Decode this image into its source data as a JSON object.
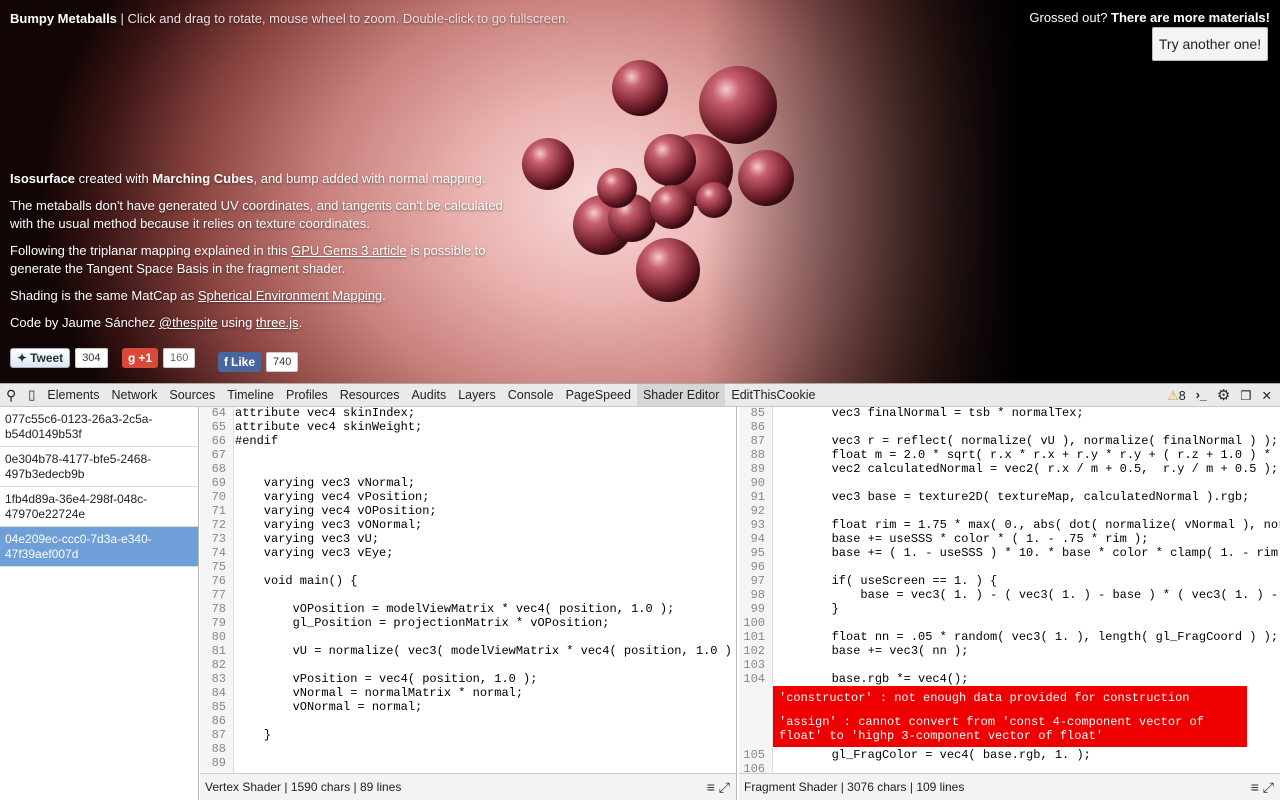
{
  "scene": {
    "title": "Bumpy Metaballs",
    "title_sub": " | Click and drag to rotate, mouse wheel to zoom. Double-click to go fullscreen.",
    "materials_prefix": "Grossed out? ",
    "materials_bold": "There are more materials!",
    "try_button": "Try another one!",
    "p1_b1": "Isosurface",
    "p1_t1": " created with ",
    "p1_b2": "Marching Cubes",
    "p1_t2": ", and bump added with normal mapping.",
    "p2": "The metaballs don't have generated UV coordinates, and tangents can't be calculated with the usual method because it relies on texture coordinates.",
    "p3_t1": "Following the triplanar mapping explained in this ",
    "p3_link": "GPU Gems 3 article",
    "p3_t2": " is possible to generate the Tangent Space Basis in the fragment shader.",
    "p4_t1": "Shading is the same MatCap as ",
    "p4_link": "Spherical Environment Mapping",
    "p4_t2": ".",
    "p5_t1": "Code by Jaume Sánchez ",
    "p5_link1": "@thespite",
    "p5_t2": " using ",
    "p5_link2": "three.js",
    "p5_t3": "."
  },
  "social": {
    "tweet_label": "Tweet",
    "tweet_count": "304",
    "gplus_label": "+1",
    "gplus_count": "160",
    "fb_label": "Like",
    "fb_count": "740"
  },
  "devtools": {
    "tabs": [
      "Elements",
      "Network",
      "Sources",
      "Timeline",
      "Profiles",
      "Resources",
      "Audits",
      "Layers",
      "Console",
      "PageSpeed",
      "Shader Editor",
      "EditThisCookie"
    ],
    "warnings": "8"
  },
  "programs": [
    "077c55c6-0123-26a3-2c5a-b54d0149b53f",
    "0e304b78-4177-bfe5-2468-497b3edecb9b",
    "1fb4d89a-36e4-298f-048c-47970e22724e",
    "04e209ec-ccc0-7d3a-e340-47f39aef007d"
  ],
  "vertex": {
    "status": "Vertex Shader | 1590 chars | 89 lines",
    "lines": [
      [
        "64",
        "attribute vec4 skinIndex;"
      ],
      [
        "65",
        "attribute vec4 skinWeight;"
      ],
      [
        "66",
        "#endif"
      ],
      [
        "67",
        ""
      ],
      [
        "68",
        ""
      ],
      [
        "69",
        "    varying vec3 vNormal;"
      ],
      [
        "70",
        "    varying vec4 vPosition;"
      ],
      [
        "71",
        "    varying vec4 vOPosition;"
      ],
      [
        "72",
        "    varying vec3 vONormal;"
      ],
      [
        "73",
        "    varying vec3 vU;"
      ],
      [
        "74",
        "    varying vec3 vEye;"
      ],
      [
        "75",
        ""
      ],
      [
        "76",
        "    void main() {"
      ],
      [
        "77",
        ""
      ],
      [
        "78",
        "        vOPosition = modelViewMatrix * vec4( position, 1.0 );"
      ],
      [
        "79",
        "        gl_Position = projectionMatrix * vOPosition;"
      ],
      [
        "80",
        ""
      ],
      [
        "81",
        "        vU = normalize( vec3( modelViewMatrix * vec4( position, 1.0 )"
      ],
      [
        "82",
        ""
      ],
      [
        "83",
        "        vPosition = vec4( position, 1.0 );"
      ],
      [
        "84",
        "        vNormal = normalMatrix * normal;"
      ],
      [
        "85",
        "        vONormal = normal;"
      ],
      [
        "86",
        ""
      ],
      [
        "87",
        "    }"
      ],
      [
        "88",
        ""
      ],
      [
        "89",
        ""
      ]
    ]
  },
  "fragment": {
    "status": "Fragment Shader | 3076 chars | 109 lines",
    "lines_before": [
      [
        "85",
        "        vec3 finalNormal = tsb * normalTex;"
      ],
      [
        "86",
        ""
      ],
      [
        "87",
        "        vec3 r = reflect( normalize( vU ), normalize( finalNormal ) );"
      ],
      [
        "88",
        "        float m = 2.0 * sqrt( r.x * r.x + r.y * r.y + ( r.z + 1.0 ) * ("
      ],
      [
        "89",
        "        vec2 calculatedNormal = vec2( r.x / m + 0.5,  r.y / m + 0.5 );"
      ],
      [
        "90",
        ""
      ],
      [
        "91",
        "        vec3 base = texture2D( textureMap, calculatedNormal ).rgb;"
      ],
      [
        "92",
        ""
      ],
      [
        "93",
        "        float rim = 1.75 * max( 0., abs( dot( normalize( vNormal ), norma"
      ],
      [
        "94",
        "        base += useSSS * color * ( 1. - .75 * rim );"
      ],
      [
        "95",
        "        base += ( 1. - useSSS ) * 10. * base * color * clamp( 1. - rim"
      ],
      [
        "96",
        ""
      ],
      [
        "97",
        "        if( useScreen == 1. ) {"
      ],
      [
        "98",
        "            base = vec3( 1. ) - ( vec3( 1. ) - base ) * ( vec3( 1. ) -"
      ],
      [
        "99",
        "        }"
      ],
      [
        "100",
        ""
      ],
      [
        "101",
        "        float nn = .05 * random( vec3( 1. ), length( gl_FragCoord ) );"
      ],
      [
        "102",
        "        base += vec3( nn );"
      ],
      [
        "103",
        ""
      ],
      [
        "104",
        "        base.rgb *= vec4();"
      ]
    ],
    "lines_after": [
      [
        "105",
        "        gl_FragColor = vec4( base.rgb, 1. );"
      ],
      [
        "106",
        ""
      ]
    ],
    "errors": [
      "'constructor' : not enough data provided for construction",
      "'assign' : cannot convert from 'const 4-component vector of float' to 'highp 3-component vector of float'"
    ]
  }
}
